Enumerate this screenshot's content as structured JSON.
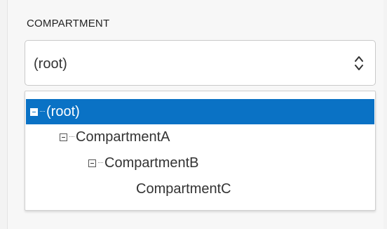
{
  "field": {
    "label": "COMPARTMENT",
    "selected_value": "(root)"
  },
  "tree": {
    "items": [
      {
        "label": "(root)",
        "level": 0,
        "expanded": true,
        "selected": true
      },
      {
        "label": "CompartmentA",
        "level": 1,
        "expanded": true,
        "selected": false
      },
      {
        "label": "CompartmentB",
        "level": 2,
        "expanded": true,
        "selected": false
      },
      {
        "label": "CompartmentC",
        "level": 3,
        "expanded": false,
        "selected": false
      }
    ]
  },
  "colors": {
    "selected_bg": "#0a72c5",
    "selected_text": "#ffffff",
    "text": "#333333",
    "border": "#c9c9c9"
  },
  "icons": {
    "select_arrows": "chevron-up-down-icon",
    "collapse_toggle": "minus-box-icon"
  }
}
